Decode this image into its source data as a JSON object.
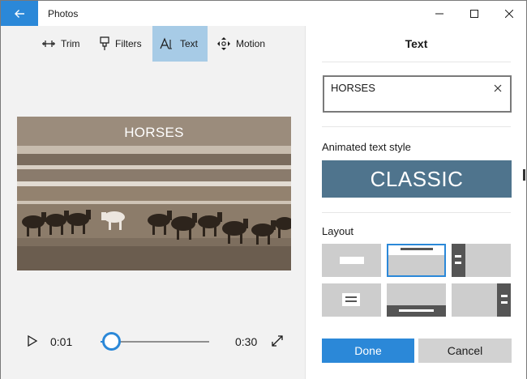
{
  "titlebar": {
    "title": "Photos",
    "back_icon": "arrow-left-icon",
    "accent": "#2b88d8"
  },
  "toolbar": {
    "tools": [
      {
        "label": "Trim",
        "icon": "trim-icon",
        "active": false
      },
      {
        "label": "Filters",
        "icon": "filters-icon",
        "active": false
      },
      {
        "label": "Text",
        "icon": "text-icon",
        "active": true
      },
      {
        "label": "Motion",
        "icon": "motion-icon",
        "active": false
      }
    ]
  },
  "preview": {
    "overlay_text": "HORSES"
  },
  "player": {
    "current_time": "0:01",
    "end_time": "0:30",
    "progress": 0.033
  },
  "panel": {
    "title": "Text",
    "text_value": "HORSES",
    "style_section_label": "Animated text style",
    "selected_style": "CLASSIC",
    "layout_section_label": "Layout",
    "layout_selected_index": 1,
    "done_label": "Done",
    "cancel_label": "Cancel"
  },
  "colors": {
    "style_tile": "#4f748d",
    "selection": "#a7cbe6",
    "done_button": "#2b88d8"
  }
}
